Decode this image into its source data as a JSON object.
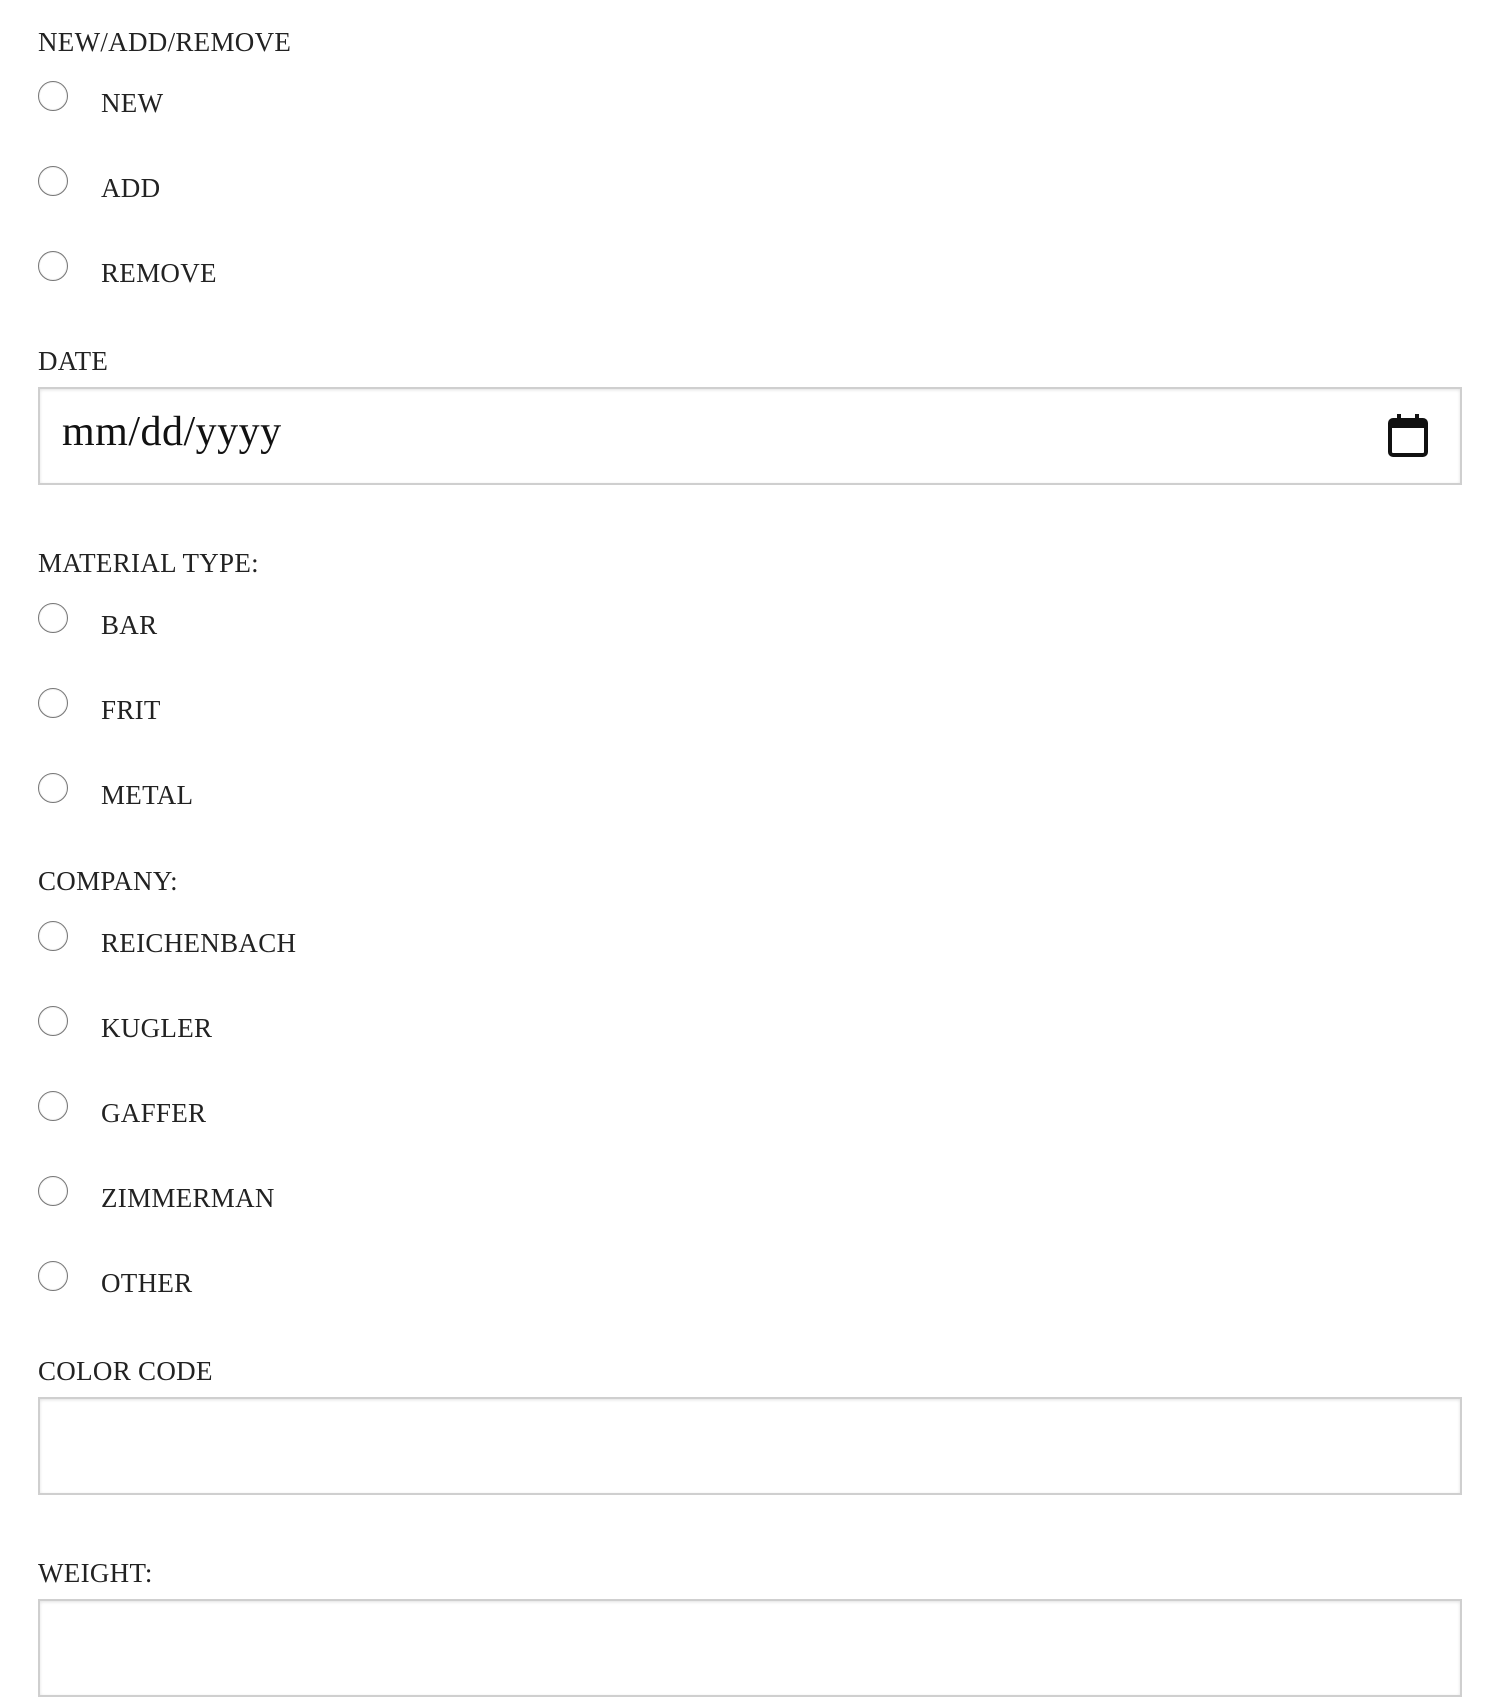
{
  "action_group": {
    "label": "NEW/ADD/REMOVE",
    "options": [
      {
        "label": "NEW",
        "checked": false
      },
      {
        "label": "ADD",
        "checked": false
      },
      {
        "label": "REMOVE",
        "checked": false
      }
    ]
  },
  "date": {
    "label": "DATE",
    "placeholder": "mm/dd/yyyy",
    "icon": "calendar-icon"
  },
  "material_type": {
    "label": "MATERIAL TYPE:",
    "options": [
      {
        "label": "BAR",
        "checked": false
      },
      {
        "label": "FRIT",
        "checked": false
      },
      {
        "label": "METAL",
        "checked": false
      }
    ]
  },
  "company": {
    "label": "COMPANY:",
    "options": [
      {
        "label": "REICHENBACH",
        "checked": false
      },
      {
        "label": "KUGLER",
        "checked": false
      },
      {
        "label": "GAFFER",
        "checked": false
      },
      {
        "label": "ZIMMERMAN",
        "checked": false
      },
      {
        "label": "OTHER",
        "checked": false
      }
    ]
  },
  "color_code": {
    "label": "COLOR CODE",
    "value": ""
  },
  "weight": {
    "label": "WEIGHT:",
    "value": ""
  }
}
